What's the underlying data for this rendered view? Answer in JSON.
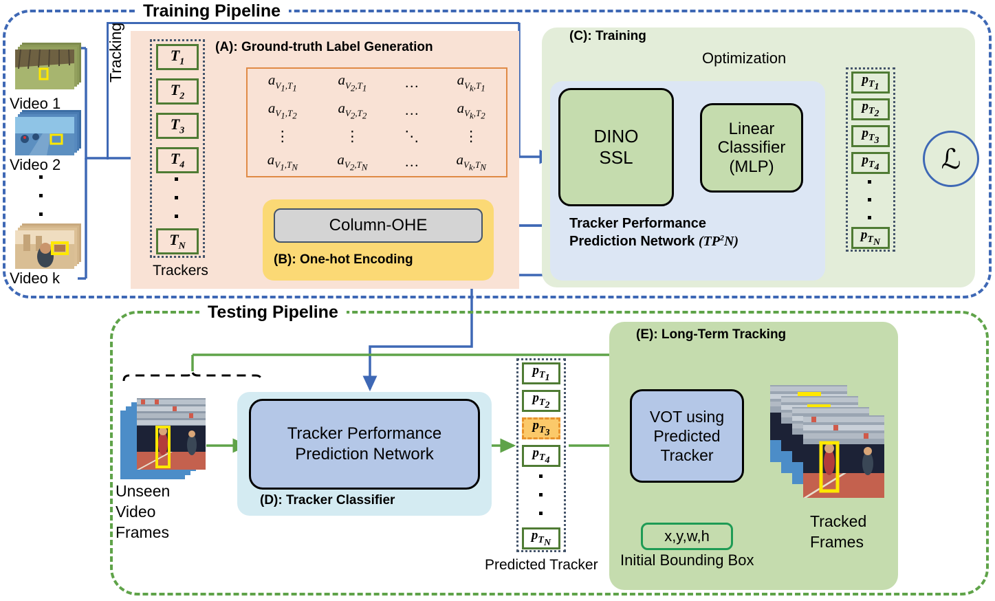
{
  "pipelines": {
    "training_title": "Training Pipeline",
    "testing_title": "Testing Pipeline"
  },
  "colors": {
    "training_border": "#3E68B5",
    "testing_border": "#5FA349",
    "section_a_bg": "#F9E2D5",
    "section_b_bg": "#FBD975",
    "section_c_bg": "#E3EDD9",
    "section_d_bg": "#D4EBF2",
    "section_e_bg": "#C5DCAE",
    "tp2n_panel_bg": "#DCE6F4",
    "model_box_green": "#C5DCAE",
    "model_box_blue": "#B4C7E7",
    "tracker_box_border": "#4F7B34",
    "matrix_border": "#E08A45",
    "highlight_fill": "#FBC96A",
    "highlight_border": "#E8922C",
    "bbox_border": "#1E9B55",
    "blue_arrow": "#3E68B5",
    "green_arrow": "#5FA349"
  },
  "videos": {
    "items": [
      {
        "label": "Video 1"
      },
      {
        "label": "Video 2"
      },
      {
        "label": "Video k"
      }
    ],
    "ellipsis": "."
  },
  "section_a": {
    "label": "(A): Ground-truth Label Generation",
    "tracking_label": "Tracking",
    "trackers_caption": "Trackers",
    "trackers": [
      {
        "base": "T",
        "sub": "1"
      },
      {
        "base": "T",
        "sub": "2"
      },
      {
        "base": "T",
        "sub": "3"
      },
      {
        "base": "T",
        "sub": "4"
      },
      {
        "base": "T",
        "sub": "N"
      }
    ],
    "matrix": {
      "rows": [
        [
          "a_{V_1,T_1}",
          "a_{V_2,T_1}",
          "...",
          "a_{V_k,T_1}"
        ],
        [
          "a_{V_1,T_2}",
          "a_{V_2,T_2}",
          "...",
          "a_{V_k,T_2}"
        ],
        [
          "vdots",
          "vdots",
          "ddots",
          "vdots"
        ],
        [
          "a_{V_1,T_N}",
          "a_{V_2,T_N}",
          "...",
          "a_{V_k,T_N}"
        ]
      ],
      "cells": [
        [
          {
            "a": "a",
            "v": "V",
            "vs": "1",
            "t": "T",
            "ts": "1"
          },
          {
            "a": "a",
            "v": "V",
            "vs": "2",
            "t": "T",
            "ts": "1"
          },
          {
            "dots": "..."
          },
          {
            "a": "a",
            "v": "V",
            "vs": "k",
            "t": "T",
            "ts": "1"
          }
        ],
        [
          {
            "a": "a",
            "v": "V",
            "vs": "1",
            "t": "T",
            "ts": "2"
          },
          {
            "a": "a",
            "v": "V",
            "vs": "2",
            "t": "T",
            "ts": "2"
          },
          {
            "dots": "..."
          },
          {
            "a": "a",
            "v": "V",
            "vs": "k",
            "t": "T",
            "ts": "2"
          }
        ],
        [
          {
            "dots": "⋮"
          },
          {
            "dots": "⋮"
          },
          {
            "dots": "⋱"
          },
          {
            "dots": "⋮"
          }
        ],
        [
          {
            "a": "a",
            "v": "V",
            "vs": "1",
            "t": "T",
            "ts": "N"
          },
          {
            "a": "a",
            "v": "V",
            "vs": "2",
            "t": "T",
            "ts": "N"
          },
          {
            "dots": "..."
          },
          {
            "a": "a",
            "v": "V",
            "vs": "k",
            "t": "T",
            "ts": "N"
          }
        ]
      ]
    }
  },
  "section_b": {
    "label": "(B): One-hot Encoding",
    "box_label": "Column-OHE"
  },
  "section_c": {
    "label": "(C): Training",
    "optimization_label": "Optimization",
    "dino_line1": "DINO",
    "dino_line2": "SSL",
    "mlp_line1": "Linear",
    "mlp_line2": "Classifier",
    "mlp_line3": "(MLP)",
    "tp2n_caption_line1": "Tracker Performance",
    "tp2n_caption_line2": "Prediction Network",
    "tp2n_acronym_prefix": "(",
    "tp2n_acronym_tp": "TP",
    "tp2n_acronym_sup": "2",
    "tp2n_acronym_n": "N",
    "tp2n_acronym_suffix": ")",
    "loss_symbol": "ℒ",
    "predictions": [
      {
        "base": "p",
        "sub": "T",
        "subsub": "1"
      },
      {
        "base": "p",
        "sub": "T",
        "subsub": "2"
      },
      {
        "base": "p",
        "sub": "T",
        "subsub": "3"
      },
      {
        "base": "p",
        "sub": "T",
        "subsub": "4"
      },
      {
        "base": "p",
        "sub": "T",
        "subsub": "N"
      }
    ]
  },
  "section_d": {
    "label": "(D): Tracker Classifier",
    "box_line1": "Tracker Performance",
    "box_line2": "Prediction Network",
    "predicted_caption": "Predicted Tracker",
    "predictions": [
      {
        "base": "p",
        "sub": "T",
        "subsub": "1",
        "highlighted": false
      },
      {
        "base": "p",
        "sub": "T",
        "subsub": "2",
        "highlighted": false
      },
      {
        "base": "p",
        "sub": "T",
        "subsub": "3",
        "highlighted": true
      },
      {
        "base": "p",
        "sub": "T",
        "subsub": "4",
        "highlighted": false
      },
      {
        "base": "p",
        "sub": "T",
        "subsub": "N",
        "highlighted": false
      }
    ]
  },
  "section_e": {
    "label": "(E): Long-Term Tracking",
    "vot_line1": "VOT using",
    "vot_line2": "Predicted",
    "vot_line3": "Tracker",
    "bbox_value": "x,y,w,h",
    "bbox_caption": "Initial Bounding Box",
    "tracked_line1": "Tracked",
    "tracked_line2": "Frames"
  },
  "testing_inputs": {
    "unseen_line1": "Unseen",
    "unseen_line2": "Video",
    "unseen_line3": "Frames"
  }
}
